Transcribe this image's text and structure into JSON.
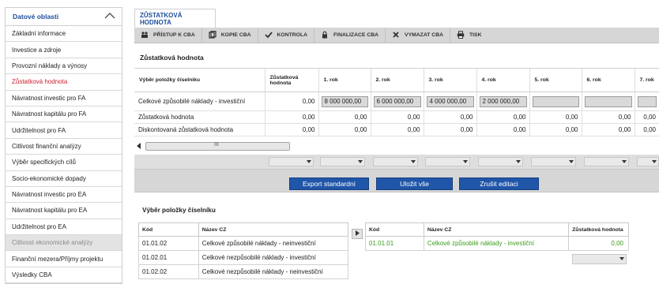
{
  "sidebar": {
    "header": "Datové oblasti",
    "items": [
      {
        "label": "Základní informace",
        "state": "normal"
      },
      {
        "label": "Investice a zdroje",
        "state": "normal"
      },
      {
        "label": "Provozní náklady a výnosy",
        "state": "normal"
      },
      {
        "label": "Zůstatková hodnota",
        "state": "active"
      },
      {
        "label": "Návratnost investic pro FA",
        "state": "normal"
      },
      {
        "label": "Návratnost kapitálu pro FA",
        "state": "normal"
      },
      {
        "label": "Udržitelnost pro FA",
        "state": "normal"
      },
      {
        "label": "Citlivost finanční analýzy",
        "state": "normal"
      },
      {
        "label": "Výběr specifických cílů",
        "state": "normal"
      },
      {
        "label": "Socio-ekonomické dopady",
        "state": "normal"
      },
      {
        "label": "Návratnost investic pro EA",
        "state": "normal"
      },
      {
        "label": "Návratnost kapitálu pro EA",
        "state": "normal"
      },
      {
        "label": "Udržitelnost pro EA",
        "state": "normal"
      },
      {
        "label": "Citlivost ekonomické analýzy",
        "state": "disabled"
      },
      {
        "label": "Finanční mezera/Příjmy projektu",
        "state": "normal"
      },
      {
        "label": "Výsledky CBA",
        "state": "normal"
      }
    ]
  },
  "tab": {
    "label": "ZŮSTATKOVÁ HODNOTA"
  },
  "toolbar": {
    "access": "PŘÍSTUP K CBA",
    "copy": "KOPIE CBA",
    "check": "KONTROLA",
    "finalize": "FINALIZACE CBA",
    "delete": "VYMAZAT CBA",
    "print": "TISK"
  },
  "section_title": "Zůstatková hodnota",
  "grid": {
    "headers": [
      "Výběr položky číselníku",
      "Zůstatková hodnota",
      "1. rok",
      "2. rok",
      "3. rok",
      "4. rok",
      "5. rok",
      "6. rok",
      "7. rok"
    ],
    "rows": [
      {
        "label": "Celkové způsobilé náklady - investiční",
        "value": "0,00",
        "years": [
          "8 000 000,00",
          "6 000 000,00",
          "4 000 000,00",
          "2 000 000,00",
          "",
          "",
          ""
        ]
      },
      {
        "label": "Zůstatková hodnota",
        "value": "0,00",
        "years": [
          "0,00",
          "0,00",
          "0,00",
          "0,00",
          "0,00",
          "0,00",
          "0,00"
        ]
      },
      {
        "label": "Diskontovaná zůstatková hodnota",
        "value": "0,00",
        "years": [
          "0,00",
          "0,00",
          "0,00",
          "0,00",
          "0,00",
          "0,00",
          "0,00"
        ]
      }
    ],
    "scroll_grip": "III"
  },
  "actions": {
    "export": "Export standardní",
    "save": "Uložit vše",
    "cancel": "Zrušit editaci"
  },
  "codebook": {
    "title": "Výběr položky číselníku",
    "left": {
      "headers": [
        "Kód",
        "Název CZ"
      ],
      "rows": [
        [
          "01.01.02",
          "Celkové způsobilé náklady - neinvestiční"
        ],
        [
          "01.02.01",
          "Celkové nezpůsobilé náklady - investiční"
        ],
        [
          "01.02.02",
          "Celkové nezpůsobilé náklady - neinvestiční"
        ]
      ]
    },
    "right": {
      "headers": [
        "Kód",
        "Název CZ",
        "Zůstatková hodnota"
      ],
      "rows": [
        [
          "01.01.01",
          "Celkové způsobilé náklady - investiční",
          "0,00"
        ]
      ]
    }
  },
  "colors": {
    "accent": "#1f4e9c",
    "active": "#cc1f2a",
    "button": "#2056a8",
    "green": "#3c9b1c"
  }
}
